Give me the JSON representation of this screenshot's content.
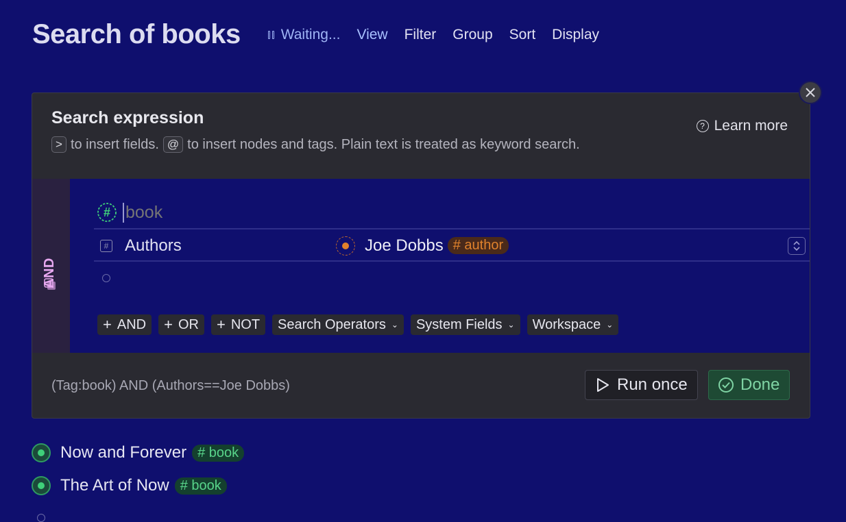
{
  "header": {
    "title": "Search of books",
    "status_label": "Waiting...",
    "menu": [
      "View",
      "Filter",
      "Group",
      "Sort",
      "Display"
    ]
  },
  "panel": {
    "title": "Search expression",
    "hint_key1": ">",
    "hint_part1": "to insert fields.",
    "hint_key2": "@",
    "hint_part2": "to insert nodes and tags. Plain text is treated as keyword search.",
    "learn_more": "Learn more"
  },
  "editor": {
    "group_operator": "AND",
    "tag_input_value": "book",
    "field_row": {
      "field_name": "Authors",
      "value": "Joe Dobbs",
      "value_tag": "# author"
    },
    "operators": [
      {
        "label": "AND",
        "prefix": "+"
      },
      {
        "label": "OR",
        "prefix": "+"
      },
      {
        "label": "NOT",
        "prefix": "+"
      },
      {
        "label": "Search Operators",
        "dropdown": true
      },
      {
        "label": "System Fields",
        "dropdown": true
      },
      {
        "label": "Workspace",
        "dropdown": true
      }
    ]
  },
  "footer": {
    "expression": "(Tag:book) AND (Authors==Joe Dobbs)",
    "run_once": "Run once",
    "done": "Done"
  },
  "results": [
    {
      "title": "Now and Forever",
      "tag": "# book"
    },
    {
      "title": "The Art of Now",
      "tag": "# book"
    }
  ],
  "colors": {
    "background": "#0f0f6e",
    "panel": "#2a2a31",
    "author_tag": "#e0822c",
    "book_tag": "#58d48a",
    "and_label": "#e7a8f0",
    "done": "#7fd4a4"
  }
}
